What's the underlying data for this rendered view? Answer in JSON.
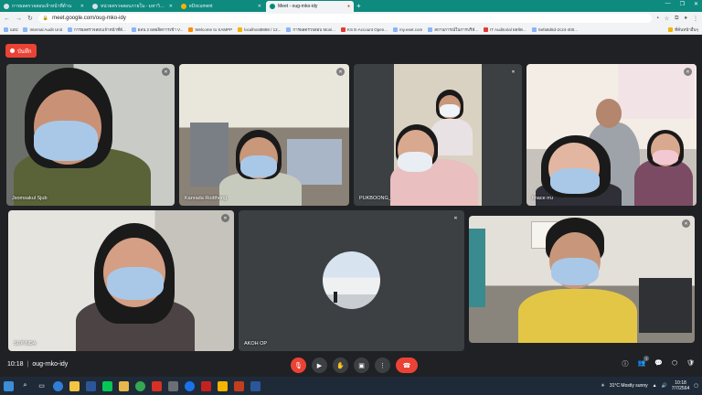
{
  "browser": {
    "tabs": [
      {
        "title": "การผลตรวจสอบเจ้าหน้าที่ด้าน",
        "active": false
      },
      {
        "title": "หน่วยตรวจสอบภายใน - มหาวิทยาลัย",
        "active": false
      },
      {
        "title": "eDocument",
        "active": false
      },
      {
        "title": "Meet - oug-rnko-idy",
        "active": true
      }
    ],
    "url": "meet.google.com/oug-mko-idy",
    "bookmarks": [
      "แอป",
      "Internal Audit Unit",
      "การผลตรวจสอบเจ้าหน้าที่ด้...",
      "ผลน 2 ผลผลิตการเข้า V...",
      "Welcome to XAMPP",
      "localhost8888 / 12...",
      "การผลตรวจสอบ Moni...",
      "KS E-Account Open...",
      "my.eset.com",
      "สถานการณ์ในการบริหั...",
      "IT Auditorial ผลจัด...",
      "Sefa8d6d-2c24-400..."
    ],
    "bookmarks_right": "ที่คั่นหน้าอื่นๆ"
  },
  "meet": {
    "record_label": "บันทึก",
    "participants": [
      {
        "name": "Jsomsakul Sjub"
      },
      {
        "name": "Kanrada Rodthong"
      },
      {
        "name": "PUKBOONG_"
      },
      {
        "name": "finace rru"
      },
      {
        "name": "SUPINDA"
      },
      {
        "name": "AKOH OP"
      },
      {
        "name": ""
      }
    ],
    "time": "10:18",
    "separator": "|",
    "meeting_code": "oug-rnko-idy",
    "participant_count": "7"
  },
  "taskbar": {
    "weather": "31°C Mostly sunny",
    "clock_time": "10:18",
    "clock_date": "7/7/2564"
  },
  "colors": {
    "tab_bar": "#0e8a7f",
    "meet_bg": "#202124",
    "record": "#ea4335"
  }
}
